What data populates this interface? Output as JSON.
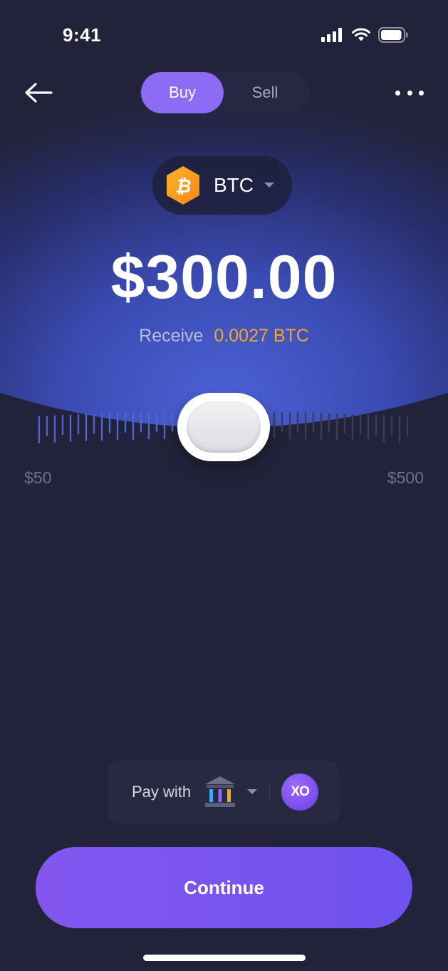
{
  "status_bar": {
    "time": "9:41",
    "battery_level": 0.95
  },
  "header": {
    "back_icon": "arrow-left-icon",
    "more_icon": "more-horizontal-icon",
    "tabs": [
      {
        "label": "Buy",
        "active": true
      },
      {
        "label": "Sell",
        "active": false
      }
    ]
  },
  "coin": {
    "symbol": "BTC",
    "icon": "bitcoin-icon",
    "icon_color": "#f7931a"
  },
  "amount": "$300.00",
  "receive": {
    "label": "Receive",
    "value": "0.0027 BTC"
  },
  "slider": {
    "min_label": "$50",
    "max_label": "$500",
    "value": 300,
    "min": 50,
    "max": 500
  },
  "pay": {
    "label": "Pay with",
    "method_icon": "bank-icon",
    "badge_text": "XO"
  },
  "continue_label": "Continue",
  "colors": {
    "background": "#22233a",
    "accent": "#8d6bf4",
    "receive_value": "#f5a623",
    "button": "#7352ee"
  }
}
